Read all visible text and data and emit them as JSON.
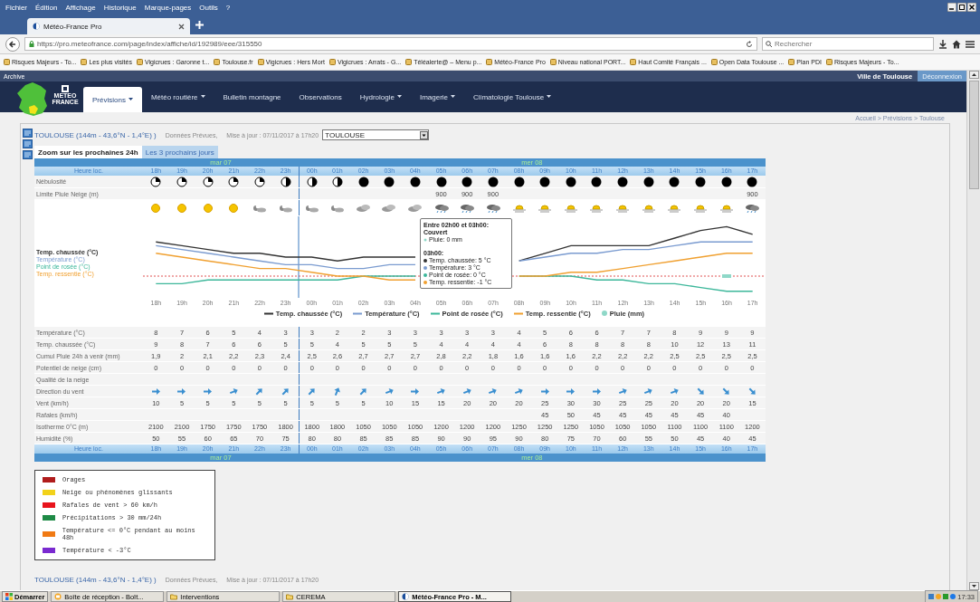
{
  "browser": {
    "menu": [
      "Fichier",
      "Édition",
      "Affichage",
      "Historique",
      "Marque-pages",
      "Outils",
      "?"
    ],
    "tab": {
      "title": "Météo-France Pro",
      "selected": true
    },
    "url": "https://pro.meteofrance.com/page/index/affiche/id/192989/eee/315550",
    "search_placeholder": "Rechercher",
    "bookmarks": [
      "Risques Majeurs - To...",
      "Les plus visités",
      "Vigicrues : Garonne t...",
      "Toulouse.fr",
      "Vigicrues : Hers Mort",
      "Vigicrues : Arrats - G...",
      "Téléalerte@ – Menu p...",
      "Météo-France Pro",
      "Niveau national PORT...",
      "Haut Comité Français ...",
      "Open Data Toulouse ...",
      "Plan PDI",
      "Risques Majeurs - To..."
    ]
  },
  "site": {
    "archive": "Archive",
    "city": "Ville de Toulouse",
    "logout": "Déconnexion",
    "logo_text": "METEO FRANCE",
    "nav": [
      {
        "label": "Prévisions",
        "dropdown": true,
        "selected": true
      },
      {
        "label": "Météo routière",
        "dropdown": true,
        "selected": false
      },
      {
        "label": "Bulletin montagne",
        "dropdown": false,
        "selected": false
      },
      {
        "label": "Observations",
        "dropdown": false,
        "selected": false
      },
      {
        "label": "Hydrologie",
        "dropdown": true,
        "selected": false
      },
      {
        "label": "Imagerie",
        "dropdown": true,
        "selected": false
      },
      {
        "label": "Climatologie Toulouse",
        "dropdown": true,
        "selected": false
      }
    ],
    "breadcrumb": "Accueil > Prévisions > Toulouse"
  },
  "forecast": {
    "station": "TOULOUSE (144m - 43,6°N - 1,4°E) )",
    "data_label": "Données Prévues,",
    "update": "Mise à jour : 07/11/2017 à 17h20",
    "select_value": "TOULOUSE",
    "tabs": [
      {
        "label": "Zoom sur les prochaines 24h",
        "selected": true
      },
      {
        "label": "Les 3 prochains jours",
        "selected": false
      }
    ],
    "top_days": [
      "mar 07",
      "mer 08"
    ],
    "top_hours": {
      "label": "Heure loc.",
      "hours": [
        {
          "label": "18h",
          "day_start": false
        },
        {
          "label": "19h",
          "day_start": false
        },
        {
          "label": "20h",
          "day_start": false
        },
        {
          "label": "21h",
          "day_start": false
        },
        {
          "label": "22h",
          "day_start": false
        },
        {
          "label": "23h",
          "day_start": false
        },
        {
          "label": "00h",
          "day_start": true
        },
        {
          "label": "01h",
          "day_start": false
        },
        {
          "label": "02h",
          "day_start": false
        },
        {
          "label": "03h",
          "day_start": false
        },
        {
          "label": "04h",
          "day_start": false
        },
        {
          "label": "05h",
          "day_start": false
        },
        {
          "label": "06h",
          "day_start": false
        },
        {
          "label": "07h",
          "day_start": false
        },
        {
          "label": "08h",
          "day_start": false
        },
        {
          "label": "09h",
          "day_start": false
        },
        {
          "label": "10h",
          "day_start": false
        },
        {
          "label": "11h",
          "day_start": false
        },
        {
          "label": "12h",
          "day_start": false
        },
        {
          "label": "13h",
          "day_start": false
        },
        {
          "label": "14h",
          "day_start": false
        },
        {
          "label": "15h",
          "day_start": false
        },
        {
          "label": "16h",
          "day_start": false
        },
        {
          "label": "17h",
          "day_start": false
        }
      ]
    },
    "rows_upper": [
      {
        "kind": "cover",
        "label": "Nébulosité",
        "cells": [
          {
            "kind": "quarter"
          },
          {
            "kind": "quarter"
          },
          {
            "kind": "quarter"
          },
          {
            "kind": "quarter"
          },
          {
            "kind": "quarter"
          },
          {
            "kind": "half"
          },
          {
            "kind": "half"
          },
          {
            "kind": "half"
          },
          {
            "kind": "full"
          },
          {
            "kind": "full"
          },
          {
            "kind": "full"
          },
          {
            "kind": "full"
          },
          {
            "kind": "full"
          },
          {
            "kind": "full"
          },
          {
            "kind": "full"
          },
          {
            "kind": "full"
          },
          {
            "kind": "full"
          },
          {
            "kind": "full"
          },
          {
            "kind": "full"
          },
          {
            "kind": "full"
          },
          {
            "kind": "full"
          },
          {
            "kind": "full"
          },
          {
            "kind": "full"
          },
          {
            "kind": "full"
          }
        ]
      },
      {
        "kind": "text",
        "label": "Limite Pluie Neige (m)",
        "cells": [
          {},
          {},
          {},
          {},
          {},
          {},
          {},
          {},
          {},
          {},
          {},
          {
            "value": "900"
          },
          {
            "value": "900"
          },
          {
            "value": "900"
          },
          {},
          {},
          {},
          {},
          {},
          {},
          {},
          {},
          {},
          {
            "value": "900"
          }
        ]
      },
      {
        "kind": "weather",
        "cells": [
          {
            "kind": "sun"
          },
          {
            "kind": "sun"
          },
          {
            "kind": "sun"
          },
          {
            "kind": "sun"
          },
          {
            "kind": "cloud-moon"
          },
          {
            "kind": "cloud-moon"
          },
          {
            "kind": "cloud-moon"
          },
          {
            "kind": "cloud-moon"
          },
          {
            "kind": "cloud"
          },
          {
            "kind": "cloud"
          },
          {
            "kind": "cloud"
          },
          {
            "kind": "dark-cloud"
          },
          {
            "kind": "dark-cloud"
          },
          {
            "kind": "dark-cloud"
          },
          {
            "kind": "sun-haze"
          },
          {
            "kind": "sun-haze"
          },
          {
            "kind": "sun-haze"
          },
          {
            "kind": "sun-haze"
          },
          {
            "kind": "sun-haze"
          },
          {
            "kind": "sun-haze"
          },
          {
            "kind": "sun-haze"
          },
          {
            "kind": "sun-haze"
          },
          {
            "kind": "sun-haze"
          },
          {
            "kind": "dark-cloud"
          }
        ]
      }
    ],
    "chart": {
      "side_labels": [
        "Temp. chaussée (°C)",
        "Température (°C)",
        "Point de rosée (°C)",
        "Temp. ressentie (°C)"
      ],
      "axis_labels": [
        "18h",
        "19h",
        "20h",
        "21h",
        "22h",
        "23h",
        "00h",
        "01h",
        "02h",
        "03h",
        "04h",
        "05h",
        "06h",
        "07h",
        "08h",
        "09h",
        "10h",
        "11h",
        "12h",
        "13h",
        "14h",
        "15h",
        "16h",
        "17h"
      ],
      "legend": [
        {
          "label": "Temp. chaussée (°C)",
          "color": "#333333",
          "kind": "line"
        },
        {
          "label": "Température (°C)",
          "color": "#7a9bd0",
          "kind": "line"
        },
        {
          "label": "Point de rosée (°C)",
          "color": "#3cb79a",
          "kind": "line"
        },
        {
          "label": "Temp. ressentie (°C)",
          "color": "#f0a030",
          "kind": "line"
        },
        {
          "label": "Pluie (mm)",
          "color": "#8fd8c8",
          "kind": "dot"
        }
      ],
      "tooltip": {
        "title": "Entre 02h00 et 03h00:",
        "condition": "Couvert",
        "rain": "Pluie: 0 mm",
        "time": "03h00:",
        "lines": [
          "Temp. chaussée: 5 °C",
          "Température: 3 °C",
          "Point de rosée: 0 °C",
          "Temp. ressentie: -1 °C"
        ]
      }
    },
    "rows_lower": [
      {
        "kind": "text",
        "label": "Température (°C)",
        "cells": [
          {
            "value": "8"
          },
          {
            "value": "7"
          },
          {
            "value": "6"
          },
          {
            "value": "5"
          },
          {
            "value": "4"
          },
          {
            "value": "3"
          },
          {
            "value": "3"
          },
          {
            "value": "2"
          },
          {
            "value": "2"
          },
          {
            "value": "3"
          },
          {
            "value": "3"
          },
          {
            "value": "3"
          },
          {
            "value": "3"
          },
          {
            "value": "3"
          },
          {
            "value": "4"
          },
          {
            "value": "5"
          },
          {
            "value": "6"
          },
          {
            "value": "6"
          },
          {
            "value": "7"
          },
          {
            "value": "7"
          },
          {
            "value": "8"
          },
          {
            "value": "9"
          },
          {
            "value": "9"
          },
          {
            "value": "9"
          }
        ]
      },
      {
        "kind": "text",
        "label": "Temp. chaussée (°C)",
        "cells": [
          {
            "value": "9"
          },
          {
            "value": "8"
          },
          {
            "value": "7"
          },
          {
            "value": "6"
          },
          {
            "value": "6"
          },
          {
            "value": "5"
          },
          {
            "value": "5"
          },
          {
            "value": "4"
          },
          {
            "value": "5"
          },
          {
            "value": "5"
          },
          {
            "value": "5"
          },
          {
            "value": "4"
          },
          {
            "value": "4"
          },
          {
            "value": "4"
          },
          {
            "value": "4"
          },
          {
            "value": "6"
          },
          {
            "value": "8"
          },
          {
            "value": "8"
          },
          {
            "value": "8"
          },
          {
            "value": "8"
          },
          {
            "value": "10"
          },
          {
            "value": "12"
          },
          {
            "value": "13"
          },
          {
            "value": "11"
          }
        ]
      },
      {
        "kind": "text",
        "label": "Cumul Pluie 24h à venir (mm)",
        "cells": [
          {
            "value": "1,9"
          },
          {
            "value": "2"
          },
          {
            "value": "2,1"
          },
          {
            "value": "2,2"
          },
          {
            "value": "2,3"
          },
          {
            "value": "2,4"
          },
          {
            "value": "2,5"
          },
          {
            "value": "2,6"
          },
          {
            "value": "2,7"
          },
          {
            "value": "2,7"
          },
          {
            "value": "2,7"
          },
          {
            "value": "2,8"
          },
          {
            "value": "2,2"
          },
          {
            "value": "1,8"
          },
          {
            "value": "1,6"
          },
          {
            "value": "1,6"
          },
          {
            "value": "1,6"
          },
          {
            "value": "2,2"
          },
          {
            "value": "2,2"
          },
          {
            "value": "2,2"
          },
          {
            "value": "2,5"
          },
          {
            "value": "2,5"
          },
          {
            "value": "2,5"
          },
          {
            "value": "2,5"
          }
        ]
      },
      {
        "kind": "text",
        "label": "Potentiel de neige (cm)",
        "cells": [
          {
            "value": "0"
          },
          {
            "value": "0"
          },
          {
            "value": "0"
          },
          {
            "value": "0"
          },
          {
            "value": "0"
          },
          {
            "value": "0"
          },
          {
            "value": "0"
          },
          {
            "value": "0"
          },
          {
            "value": "0"
          },
          {
            "value": "0"
          },
          {
            "value": "0"
          },
          {
            "value": "0"
          },
          {
            "value": "0"
          },
          {
            "value": "0"
          },
          {
            "value": "0"
          },
          {
            "value": "0"
          },
          {
            "value": "0"
          },
          {
            "value": "0"
          },
          {
            "value": "0"
          },
          {
            "value": "0"
          },
          {
            "value": "0"
          },
          {
            "value": "0"
          },
          {
            "value": "0"
          },
          {
            "value": "0"
          }
        ]
      },
      {
        "kind": "text",
        "label": "Qualité de la neige"
      },
      {
        "kind": "wind",
        "label": "Direction du vent",
        "cells": [
          {
            "kind": "east"
          },
          {
            "kind": "east"
          },
          {
            "kind": "east"
          },
          {
            "kind": "east-northeast"
          },
          {
            "kind": "northeast"
          },
          {
            "kind": "northeast"
          },
          {
            "kind": "northeast"
          },
          {
            "kind": "north-northeast"
          },
          {
            "kind": "northeast"
          },
          {
            "kind": "east-northeast"
          },
          {
            "kind": "east"
          },
          {
            "kind": "east-northeast"
          },
          {
            "kind": "east-northeast"
          },
          {
            "kind": "east-northeast"
          },
          {
            "kind": "east-northeast"
          },
          {
            "kind": "east"
          },
          {
            "kind": "east"
          },
          {
            "kind": "east"
          },
          {
            "kind": "east-northeast"
          },
          {
            "kind": "east-northeast"
          },
          {
            "kind": "east-northeast"
          },
          {
            "kind": "southeast"
          },
          {
            "kind": "southeast"
          },
          {
            "kind": "southeast"
          }
        ]
      },
      {
        "kind": "text",
        "label": "Vent (km/h)",
        "cells": [
          {
            "value": "10"
          },
          {
            "value": "5"
          },
          {
            "value": "5"
          },
          {
            "value": "5"
          },
          {
            "value": "5"
          },
          {
            "value": "5"
          },
          {
            "value": "5"
          },
          {
            "value": "5"
          },
          {
            "value": "5"
          },
          {
            "value": "10"
          },
          {
            "value": "15"
          },
          {
            "value": "15"
          },
          {
            "value": "20"
          },
          {
            "value": "20"
          },
          {
            "value": "20"
          },
          {
            "value": "25"
          },
          {
            "value": "30"
          },
          {
            "value": "30"
          },
          {
            "value": "25"
          },
          {
            "value": "25"
          },
          {
            "value": "20"
          },
          {
            "value": "20"
          },
          {
            "value": "20"
          },
          {
            "value": "15"
          }
        ]
      },
      {
        "kind": "text",
        "label": "Rafales (km/h)",
        "cells": [
          {},
          {},
          {},
          {},
          {},
          {},
          {},
          {},
          {},
          {},
          {},
          {},
          {},
          {},
          {},
          {
            "value": "45"
          },
          {
            "value": "50"
          },
          {
            "value": "45"
          },
          {
            "value": "45"
          },
          {
            "value": "45"
          },
          {
            "value": "45"
          },
          {
            "value": "45"
          },
          {
            "value": "40"
          },
          {}
        ]
      },
      {
        "kind": "text",
        "label": "Isotherme 0°C (m)",
        "cells": [
          {
            "value": "2100"
          },
          {
            "value": "2100"
          },
          {
            "value": "1750"
          },
          {
            "value": "1750"
          },
          {
            "value": "1750"
          },
          {
            "value": "1800"
          },
          {
            "value": "1800"
          },
          {
            "value": "1800"
          },
          {
            "value": "1050"
          },
          {
            "value": "1050"
          },
          {
            "value": "1050"
          },
          {
            "value": "1200"
          },
          {
            "value": "1200"
          },
          {
            "value": "1200"
          },
          {
            "value": "1250"
          },
          {
            "value": "1250"
          },
          {
            "value": "1250"
          },
          {
            "value": "1050"
          },
          {
            "value": "1050"
          },
          {
            "value": "1050"
          },
          {
            "value": "1100"
          },
          {
            "value": "1100"
          },
          {
            "value": "1100"
          },
          {
            "value": "1200"
          }
        ]
      },
      {
        "kind": "text",
        "label": "Humidité (%)",
        "cells": [
          {
            "value": "50"
          },
          {
            "value": "55"
          },
          {
            "value": "60"
          },
          {
            "value": "65"
          },
          {
            "value": "70"
          },
          {
            "value": "75"
          },
          {
            "value": "80"
          },
          {
            "value": "80"
          },
          {
            "value": "85"
          },
          {
            "value": "85"
          },
          {
            "value": "85"
          },
          {
            "value": "90"
          },
          {
            "value": "90"
          },
          {
            "value": "95"
          },
          {
            "value": "90"
          },
          {
            "value": "80"
          },
          {
            "value": "75"
          },
          {
            "value": "70"
          },
          {
            "value": "60"
          },
          {
            "value": "55"
          },
          {
            "value": "50"
          },
          {
            "value": "45"
          },
          {
            "value": "40"
          },
          {
            "value": "45"
          }
        ]
      }
    ],
    "bottom_hours": {
      "label": "Heure loc.",
      "hours": [
        {
          "label": "18h",
          "day_start": false
        },
        {
          "label": "19h",
          "day_start": false
        },
        {
          "label": "20h",
          "day_start": false
        },
        {
          "label": "21h",
          "day_start": false
        },
        {
          "label": "22h",
          "day_start": false
        },
        {
          "label": "23h",
          "day_start": false
        },
        {
          "label": "00h",
          "day_start": true
        },
        {
          "label": "01h",
          "day_start": false
        },
        {
          "label": "02h",
          "day_start": false
        },
        {
          "label": "03h",
          "day_start": false
        },
        {
          "label": "04h",
          "day_start": false
        },
        {
          "label": "05h",
          "day_start": false
        },
        {
          "label": "06h",
          "day_start": false
        },
        {
          "label": "07h",
          "day_start": false
        },
        {
          "label": "08h",
          "day_start": false
        },
        {
          "label": "09h",
          "day_start": false
        },
        {
          "label": "10h",
          "day_start": false
        },
        {
          "label": "11h",
          "day_start": false
        },
        {
          "label": "12h",
          "day_start": false
        },
        {
          "label": "13h",
          "day_start": false
        },
        {
          "label": "14h",
          "day_start": false
        },
        {
          "label": "15h",
          "day_start": false
        },
        {
          "label": "16h",
          "day_start": false
        },
        {
          "label": "17h",
          "day_start": false
        }
      ]
    },
    "bottom_days": [
      "mar 07",
      "mer 08"
    ]
  },
  "alerts_legend": [
    {
      "label": "Orages",
      "color": "#b01c1c"
    },
    {
      "label": "Neige ou phénomènes glissants",
      "color": "#f2d21a"
    },
    {
      "label": "Rafales de vent > 60 km/h",
      "color": "#e8141c"
    },
    {
      "label": "Précipitations > 30 mm/24h",
      "color": "#1e8a46"
    },
    {
      "label": "Température <= 0°C pendant au moins 48h",
      "color": "#f07a14"
    },
    {
      "label": "Température < -3°C",
      "color": "#7a2ad0"
    }
  ],
  "footer": {
    "station": "TOULOUSE (144m - 43,6°N - 1,4°E) )",
    "data_label": "Données Prévues,",
    "update": "Mise à jour : 07/11/2017 à 17h20"
  },
  "taskbar": {
    "start": "Démarrer",
    "items": [
      {
        "label": "Boîte de réception - Boît...",
        "kind": "mail",
        "selected": false
      },
      {
        "label": "Interventions",
        "kind": "folder",
        "selected": false
      },
      {
        "label": "CEREMA",
        "kind": "folder",
        "selected": false
      },
      {
        "label": "Météo-France Pro - M...",
        "kind": "browser",
        "selected": true
      }
    ],
    "clock": "17:33"
  }
}
